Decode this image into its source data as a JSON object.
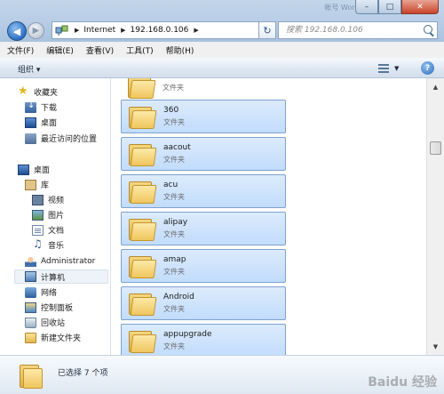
{
  "window": {
    "ghost_title": "帐号 Word …",
    "minimize": "–",
    "maximize": "□",
    "close": "✕"
  },
  "address": {
    "crumbs": [
      "Internet",
      "192.168.0.106"
    ],
    "refresh": "↻"
  },
  "search": {
    "placeholder": "搜索 192.168.0.106"
  },
  "menu": [
    "文件(F)",
    "编辑(E)",
    "查看(V)",
    "工具(T)",
    "帮助(H)"
  ],
  "toolbar": {
    "organize_label": "组织 ▾"
  },
  "nav": {
    "favorites": "收藏夹",
    "downloads": "下载",
    "desktop_fav": "桌面",
    "recent": "最近访问的位置",
    "desktop": "桌面",
    "libraries": "库",
    "videos": "视频",
    "pictures": "图片",
    "documents": "文档",
    "music": "音乐",
    "admin": "Administrator",
    "computer": "计算机",
    "network": "网络",
    "control_panel": "控制面板",
    "recycle_bin": "回收站",
    "new_folder": "新建文件夹"
  },
  "items": [
    {
      "name": "",
      "type": "文件夹",
      "selected": false
    },
    {
      "name": "360",
      "type": "文件夹",
      "selected": true
    },
    {
      "name": "aacout",
      "type": "文件夹",
      "selected": true
    },
    {
      "name": "acu",
      "type": "文件夹",
      "selected": true
    },
    {
      "name": "alipay",
      "type": "文件夹",
      "selected": true
    },
    {
      "name": "amap",
      "type": "文件夹",
      "selected": true
    },
    {
      "name": "Android",
      "type": "文件夹",
      "selected": true
    },
    {
      "name": "appupgrade",
      "type": "文件夹",
      "selected": true
    }
  ],
  "status": {
    "text": "已选择 7 个项"
  },
  "watermark": "Baidu 经验"
}
